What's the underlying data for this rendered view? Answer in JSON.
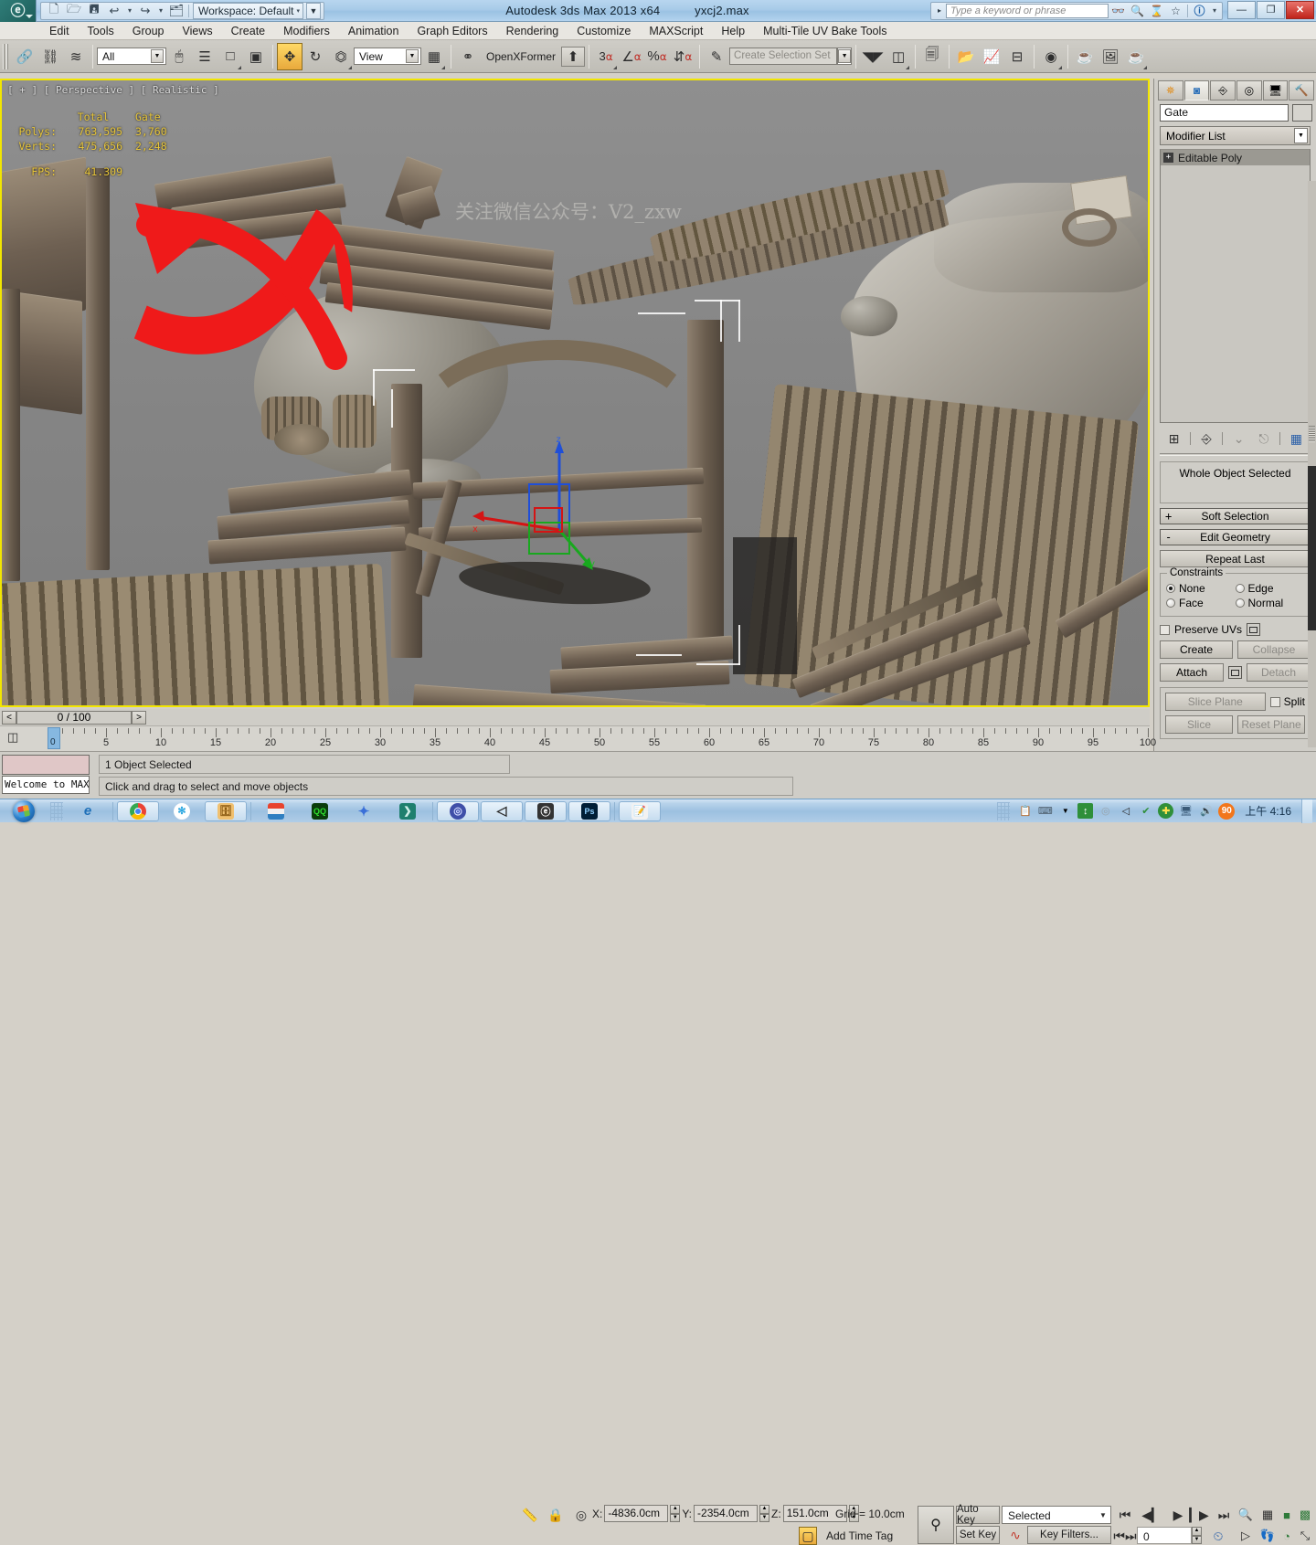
{
  "titlebar": {
    "app_logo": "3dsmax-logo-icon",
    "quick_access": [
      {
        "name": "new-file-icon",
        "glyph": "🗋"
      },
      {
        "name": "open-file-icon",
        "glyph": "🗁"
      },
      {
        "name": "save-file-icon",
        "glyph": "🖫"
      },
      {
        "name": "undo-icon",
        "glyph": "↩"
      },
      {
        "name": "undo-dropdown-icon",
        "glyph": "▾"
      },
      {
        "name": "redo-icon",
        "glyph": "↪"
      },
      {
        "name": "redo-dropdown-icon",
        "glyph": "▾"
      },
      {
        "name": "project-folder-icon",
        "glyph": "🗂"
      }
    ],
    "workspace_label": "Workspace: Default",
    "workspace_dropdown_glyph": "▾",
    "workspace_menu_glyph": "▼",
    "app_title": "Autodesk 3ds Max  2013 x64",
    "file_name": "yxcj2.max",
    "search_placeholder": "Type a keyword or phrase",
    "search_arrow_glyph": "▸",
    "help_icons": [
      {
        "name": "search-binoculars-icon",
        "glyph": "👓"
      },
      {
        "name": "search-magnifier-icon",
        "glyph": "🔍"
      },
      {
        "name": "subscription-icon",
        "glyph": "⧖"
      },
      {
        "name": "favorites-star-icon",
        "glyph": "☆"
      },
      {
        "name": "help-question-icon",
        "glyph": "?"
      },
      {
        "name": "help-dropdown-icon",
        "glyph": "▾"
      }
    ],
    "window_buttons": [
      {
        "name": "minimize-button",
        "glyph": "—"
      },
      {
        "name": "restore-button",
        "glyph": "❐"
      },
      {
        "name": "close-button",
        "glyph": "✕"
      }
    ]
  },
  "menubar": {
    "items": [
      {
        "name": "menu-edit",
        "label": "Edit"
      },
      {
        "name": "menu-tools",
        "label": "Tools"
      },
      {
        "name": "menu-group",
        "label": "Group"
      },
      {
        "name": "menu-views",
        "label": "Views"
      },
      {
        "name": "menu-create",
        "label": "Create"
      },
      {
        "name": "menu-modifiers",
        "label": "Modifiers"
      },
      {
        "name": "menu-animation",
        "label": "Animation"
      },
      {
        "name": "menu-graph-editors",
        "label": "Graph Editors"
      },
      {
        "name": "menu-rendering",
        "label": "Rendering"
      },
      {
        "name": "menu-customize",
        "label": "Customize"
      },
      {
        "name": "menu-maxscript",
        "label": "MAXScript"
      },
      {
        "name": "menu-help",
        "label": "Help"
      },
      {
        "name": "menu-multi-tile-uv-bake-tools",
        "label": "Multi-Tile UV Bake Tools"
      }
    ]
  },
  "toolbar": {
    "select_filter_value": "All",
    "reference_coord_value": "View",
    "openxformer_label": "OpenXFormer",
    "selection_set_placeholder": "Create Selection Set",
    "snap_number": "3",
    "buttons": [
      {
        "name": "select-and-link-icon",
        "glyph": "🔗"
      },
      {
        "name": "unlink-selection-icon",
        "glyph": "⛓"
      },
      {
        "name": "bind-to-space-warp-icon",
        "glyph": "≋"
      },
      {
        "name": "select-object-icon",
        "glyph": "▯"
      },
      {
        "name": "select-by-name-icon",
        "glyph": "▤"
      },
      {
        "name": "rectangular-selection-region-icon",
        "glyph": "▭"
      },
      {
        "name": "window-crossing-icon",
        "glyph": "▣"
      },
      {
        "name": "select-and-move-icon",
        "glyph": "✥"
      },
      {
        "name": "select-and-rotate-icon",
        "glyph": "↺"
      },
      {
        "name": "select-and-scale-icon",
        "glyph": "⧄"
      },
      {
        "name": "use-center-flyout-icon",
        "glyph": "◨"
      },
      {
        "name": "select-and-manipulate-icon",
        "glyph": "⚯"
      },
      {
        "name": "openxformer-button-icon",
        "glyph": "⬆"
      },
      {
        "name": "snaps-toggle-icon",
        "glyph": "🧲"
      },
      {
        "name": "angle-snap-toggle-icon",
        "glyph": "∠"
      },
      {
        "name": "percent-snap-toggle-icon",
        "glyph": "%"
      },
      {
        "name": "spinner-snap-toggle-icon",
        "glyph": "⇅"
      },
      {
        "name": "edit-named-selection-sets-icon",
        "glyph": "✎"
      },
      {
        "name": "mirror-icon",
        "glyph": "Ⓜ"
      },
      {
        "name": "align-icon",
        "glyph": "▤"
      },
      {
        "name": "layer-manager-icon",
        "glyph": "🗐"
      },
      {
        "name": "toggle-scene-explorer-icon",
        "glyph": "📂"
      },
      {
        "name": "curve-editor-icon",
        "glyph": "📈"
      },
      {
        "name": "schematic-view-icon",
        "glyph": "⊟"
      },
      {
        "name": "material-editor-icon",
        "glyph": "◍"
      },
      {
        "name": "render-setup-icon",
        "glyph": "🫖"
      },
      {
        "name": "rendered-frame-window-icon",
        "glyph": "🖼"
      },
      {
        "name": "render-production-icon",
        "glyph": "🫖"
      }
    ]
  },
  "viewport": {
    "label": "[ + ] [ Perspective ] [ Realistic ]",
    "watermark": "关注微信公众号：V2_zxw",
    "stats": {
      "col_total": "Total",
      "col_object": "Gate",
      "polys_label": "Polys:",
      "polys_total": "763,595",
      "polys_object": "3,760",
      "verts_label": "Verts:",
      "verts_total": "475,656",
      "verts_object": "2,248",
      "fps_label": "FPS:",
      "fps_value": "41.309"
    },
    "gizmo": {
      "x_label": "x",
      "y_label": "y",
      "z_label": "z"
    },
    "annotation": "red-arrow-annotation"
  },
  "command_panel": {
    "tabs": [
      {
        "name": "tab-create",
        "glyph": "✳",
        "selected": false
      },
      {
        "name": "tab-modify",
        "glyph": "◝",
        "selected": true
      },
      {
        "name": "tab-hierarchy",
        "glyph": "⛬",
        "selected": false
      },
      {
        "name": "tab-motion",
        "glyph": "◎",
        "selected": false
      },
      {
        "name": "tab-display",
        "glyph": "🖵",
        "selected": false
      },
      {
        "name": "tab-utilities",
        "glyph": "🔨",
        "selected": false
      }
    ],
    "object_name": "Gate",
    "modifier_list_label": "Modifier List",
    "modifier_dropdown_glyph": "▼",
    "modifier_stack": [
      {
        "name": "modifier-editable-poly",
        "label": "Editable Poly",
        "expand_glyph": "+"
      }
    ],
    "stack_buttons": [
      {
        "name": "pin-stack-icon",
        "glyph": "⊶"
      },
      {
        "name": "show-end-result-icon",
        "glyph": "⑂"
      },
      {
        "name": "make-unique-icon",
        "glyph": "⋎"
      },
      {
        "name": "remove-modifier-icon",
        "glyph": "🗑"
      },
      {
        "name": "configure-modifier-sets-icon",
        "glyph": "▦"
      }
    ],
    "selection_readout": "Whole Object Selected",
    "rollouts": [
      {
        "name": "rollout-soft-selection",
        "label": "Soft Selection",
        "sign": "+"
      },
      {
        "name": "rollout-edit-geometry",
        "label": "Edit Geometry",
        "sign": "-"
      }
    ],
    "repeat_last_label": "Repeat Last",
    "constraints_group_label": "Constraints",
    "constraints": [
      {
        "name": "constraint-none",
        "label": "None",
        "selected": true
      },
      {
        "name": "constraint-edge",
        "label": "Edge",
        "selected": false
      },
      {
        "name": "constraint-face",
        "label": "Face",
        "selected": false
      },
      {
        "name": "constraint-normal",
        "label": "Normal",
        "selected": false
      }
    ],
    "preserve_uvs_label": "Preserve UVs",
    "buttons": [
      {
        "name": "create-button",
        "label": "Create",
        "disabled": false
      },
      {
        "name": "collapse-button",
        "label": "Collapse",
        "disabled": true
      },
      {
        "name": "attach-button",
        "label": "Attach",
        "disabled": false
      },
      {
        "name": "detach-button",
        "label": "Detach",
        "disabled": true
      },
      {
        "name": "slice-plane-button",
        "label": "Slice Plane",
        "disabled": true
      },
      {
        "name": "split-checkbox",
        "label": "Split",
        "disabled": false
      },
      {
        "name": "slice-button",
        "label": "Slice",
        "disabled": true
      },
      {
        "name": "reset-plane-button",
        "label": "Reset Plane",
        "disabled": true
      }
    ]
  },
  "time_slider": {
    "prev_glyph": "<",
    "next_glyph": ">",
    "current": "0 / 100",
    "ruler_labels": [
      "0",
      "5",
      "10",
      "15",
      "20",
      "25",
      "30",
      "35",
      "40",
      "45",
      "50",
      "55",
      "60",
      "65",
      "70",
      "75",
      "80",
      "85",
      "90",
      "95",
      "100"
    ],
    "playhead_value": "0"
  },
  "status_bar": {
    "maxscript_listener_text": "Welcome to MAXS",
    "selection_status": "1 Object Selected",
    "prompt": "Click and drag to select and move objects",
    "isolate_icon": "isolate-selection-icon",
    "lock_icon": "selection-lock-icon",
    "coord_icon": "absolute-relative-mode-icon",
    "x_label": "X:",
    "x_value": "-4836.0cm",
    "y_label": "Y:",
    "y_value": "-2354.0cm",
    "z_label": "Z:",
    "z_value": "151.0cm",
    "grid_label": "Grid = 10.0cm",
    "add_time_tag": "Add Time Tag",
    "key_mode_icon": "key-mode-toggle-icon",
    "auto_key": "Auto Key",
    "set_key": "Set Key",
    "key_filter_set": "Selected",
    "key_filters": "Key Filters...",
    "curve_icon": "set-key-curve-icon",
    "frame_value": "0",
    "playback_buttons": [
      {
        "name": "go-to-start-button",
        "glyph": "⏮"
      },
      {
        "name": "previous-frame-button",
        "glyph": "◀▮"
      },
      {
        "name": "play-animation-button",
        "glyph": "▶"
      },
      {
        "name": "next-frame-button",
        "glyph": "▮▶"
      },
      {
        "name": "go-to-end-button",
        "glyph": "⏭"
      }
    ],
    "nav_buttons": [
      {
        "name": "zoom-icon",
        "glyph": "🔍"
      },
      {
        "name": "zoom-all-icon",
        "glyph": "▦"
      },
      {
        "name": "zoom-extents-icon",
        "glyph": "⬛"
      },
      {
        "name": "zoom-extents-all-icon",
        "glyph": "▩"
      },
      {
        "name": "field-of-view-icon",
        "glyph": "▷"
      },
      {
        "name": "walk-through-icon",
        "glyph": "👣"
      },
      {
        "name": "arc-rotate-icon",
        "glyph": "◔"
      },
      {
        "name": "maximize-viewport-toggle-icon",
        "glyph": "⤢"
      }
    ],
    "key_mode_toggle_icon": "key-mode-toggle-icon",
    "time_config_icon": "time-configuration-icon"
  },
  "taskbar": {
    "start_button": "windows-start-orb",
    "apps": [
      {
        "name": "taskbar-internet-explorer",
        "glyph": "e",
        "color": "#1e6fb8",
        "bg": "transparent"
      },
      {
        "name": "taskbar-google-chrome",
        "glyph": "◉",
        "color": "#fff",
        "bg": "#4285f4"
      },
      {
        "name": "taskbar-360-browser",
        "glyph": "✿",
        "color": "#2ba7e0",
        "bg": "#ffffff"
      },
      {
        "name": "taskbar-file-explorer",
        "glyph": "🗂",
        "color": "#e8a33d",
        "bg": "#f4d08a"
      },
      {
        "name": "taskbar-winrar",
        "glyph": "▤",
        "color": "#fff",
        "bg": "#2f7fc1"
      },
      {
        "name": "taskbar-qq",
        "glyph": "Q",
        "color": "#0f0",
        "bg": "#0a3a0a"
      },
      {
        "name": "taskbar-foxmail",
        "glyph": "✦",
        "color": "#3a6fd8",
        "bg": "transparent"
      },
      {
        "name": "taskbar-substance",
        "glyph": "❯",
        "color": "#fff",
        "bg": "#1e7f6e"
      },
      {
        "name": "taskbar-app-blue",
        "glyph": "◎",
        "color": "#fff",
        "bg": "#3f4fa8"
      },
      {
        "name": "taskbar-unity",
        "glyph": "◁",
        "color": "#2b2b2b",
        "bg": "#f0f0f0"
      },
      {
        "name": "taskbar-3ds-max",
        "glyph": "S",
        "color": "#fff",
        "bg": "#333333"
      },
      {
        "name": "taskbar-photoshop",
        "glyph": "Ps",
        "color": "#8fd0ff",
        "bg": "#001e36"
      },
      {
        "name": "taskbar-notepad",
        "glyph": "📝",
        "color": "#2b6cb0",
        "bg": "#f2f2f2"
      }
    ],
    "tray": [
      {
        "name": "tray-notes-icon",
        "glyph": "📋"
      },
      {
        "name": "tray-keyboard-icon",
        "glyph": "⌨"
      },
      {
        "name": "tray-overflow-icon",
        "glyph": "▾"
      },
      {
        "name": "tray-usb-icon",
        "glyph": "🔌"
      },
      {
        "name": "tray-360-icon",
        "glyph": "◎"
      },
      {
        "name": "tray-unity-icon",
        "glyph": "◁"
      },
      {
        "name": "tray-safe-remove-icon",
        "glyph": "✔"
      },
      {
        "name": "tray-security-icon",
        "glyph": "✛"
      },
      {
        "name": "tray-network-icon",
        "glyph": "🖧"
      },
      {
        "name": "tray-volume-icon",
        "glyph": "🔊"
      },
      {
        "name": "tray-score-badge",
        "glyph": "90"
      }
    ],
    "clock": "上午 4:16"
  },
  "colors": {
    "accent_yellow": "#f2e600",
    "viewport_bg": "#8b8b8b",
    "panel_bg": "#cfcdc7",
    "stat_text": "#e8c63a",
    "annotation_red": "#ef1a1a",
    "badge_orange": "#f2761b"
  }
}
